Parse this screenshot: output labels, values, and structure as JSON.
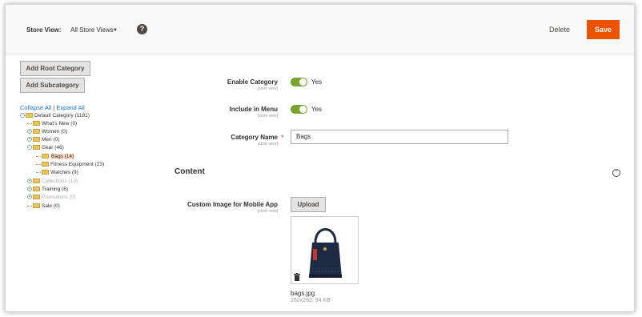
{
  "header": {
    "store_view_label": "Store View:",
    "store_view_value": "All Store Views",
    "help_icon": "question-circle-icon",
    "delete_label": "Delete",
    "save_label": "Save",
    "save_color": "#eb5202"
  },
  "sidebar": {
    "add_root_label": "Add Root Category",
    "add_sub_label": "Add Subcategory",
    "collapse_all": "Collapse All",
    "separator": "|",
    "expand_all": "Expand All",
    "tree": [
      {
        "label": "Default Category (1181)",
        "depth": 0,
        "expander": "minus",
        "state": "normal"
      },
      {
        "label": "What's New (0)",
        "depth": 1,
        "expander": "none",
        "state": "normal"
      },
      {
        "label": "Women (0)",
        "depth": 1,
        "expander": "plus",
        "state": "normal"
      },
      {
        "label": "Men (0)",
        "depth": 1,
        "expander": "plus",
        "state": "normal"
      },
      {
        "label": "Gear (46)",
        "depth": 1,
        "expander": "minus",
        "state": "normal"
      },
      {
        "label": "Bags (14)",
        "depth": 2,
        "expander": "none",
        "state": "active"
      },
      {
        "label": "Fitness Equipment (23)",
        "depth": 2,
        "expander": "none",
        "state": "normal"
      },
      {
        "label": "Watches (9)",
        "depth": 2,
        "expander": "none",
        "state": "normal"
      },
      {
        "label": "Collections (13)",
        "depth": 1,
        "expander": "plus",
        "state": "inactive"
      },
      {
        "label": "Training (6)",
        "depth": 1,
        "expander": "plus",
        "state": "normal"
      },
      {
        "label": "Promotions (0)",
        "depth": 1,
        "expander": "plus",
        "state": "inactive"
      },
      {
        "label": "Sale (0)",
        "depth": 1,
        "expander": "none",
        "state": "normal"
      }
    ]
  },
  "form": {
    "enable_category": {
      "label": "Enable Category",
      "scope": "[store view]",
      "value": "Yes"
    },
    "include_in_menu": {
      "label": "Include in Menu",
      "scope": "[store view]",
      "value": "Yes"
    },
    "category_name": {
      "label": "Category Name",
      "scope": "[store view]",
      "required_mark": "*",
      "value": "Bags"
    },
    "toggle_color": "#79a22e"
  },
  "content": {
    "title": "Content",
    "collapse_icon": "chevron-up-circle-icon",
    "custom_image": {
      "label": "Custom Image for Mobile App",
      "scope": "[store view]",
      "upload_label": "Upload",
      "file_name": "bags.jpg",
      "file_meta": "262x262, 94 KB"
    }
  }
}
